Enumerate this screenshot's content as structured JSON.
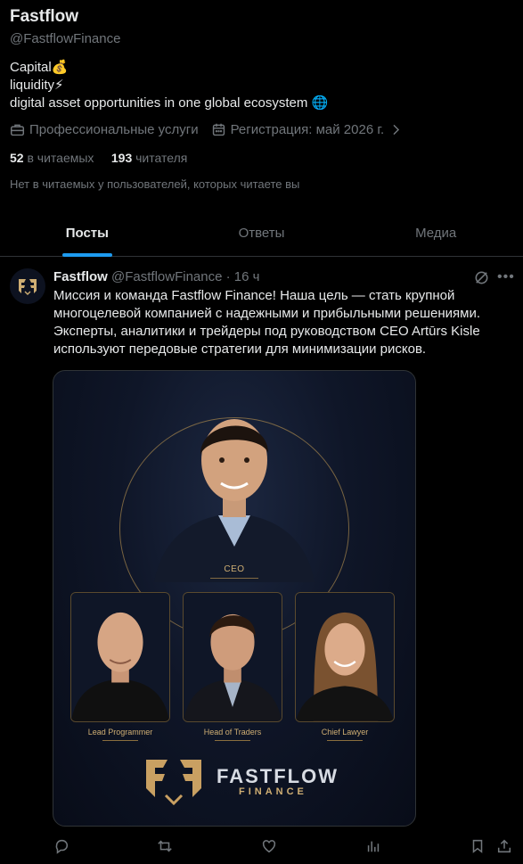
{
  "profile": {
    "name": "Fastflow",
    "handle": "@FastflowFinance",
    "bio_line1": "Capital💰",
    "bio_line2": "liquidity⚡",
    "bio_line3": "digital asset opportunities in one global ecosystem 🌐",
    "category": "Профессиональные услуги",
    "joined": "Регистрация: май 2026 г.",
    "following_count": "52",
    "following_label": "в читаемых",
    "followers_count": "193",
    "followers_label": "читателя",
    "followers_note": "Нет в читаемых у пользователей, которых читаете вы"
  },
  "tabs": [
    {
      "label": "Посты",
      "active": true
    },
    {
      "label": "Ответы",
      "active": false
    },
    {
      "label": "Медиа",
      "active": false
    }
  ],
  "post": {
    "author": "Fastflow",
    "handle_time": "@FastflowFinance · 16 ч",
    "text": "Миссия и команда Fastflow Finance!  Наша цель — стать крупной многоцелевой компанией с надежными и прибыльными решениями. Эксперты, аналитики и трейдеры под руководством CEO Artūrs Kisle используют передовые стратегии для минимизации рисков.",
    "media": {
      "ceo_label": "CEO",
      "team": [
        {
          "label": "Lead Programmer"
        },
        {
          "label": "Head of Traders"
        },
        {
          "label": "Chief Lawyer"
        }
      ],
      "logo_word": "FASTFLOW",
      "logo_sub": "FINANCE"
    }
  },
  "colors": {
    "background": "#000000",
    "text": "#e7e9ea",
    "muted": "#71767b",
    "accent": "#1d9bf0",
    "gold": "#cfae73"
  },
  "icons": [
    "briefcase-icon",
    "calendar-icon",
    "chevron-right-icon",
    "grok-icon",
    "more-icon",
    "reply-icon",
    "repost-icon",
    "like-icon",
    "views-icon",
    "bookmark-icon",
    "share-icon"
  ]
}
